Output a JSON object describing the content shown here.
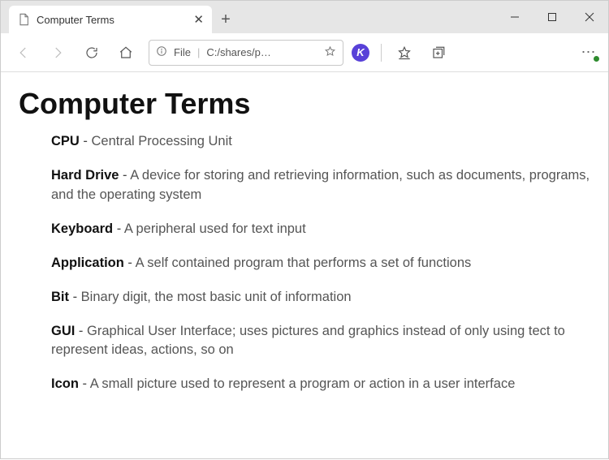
{
  "tab": {
    "title": "Computer Terms"
  },
  "address": {
    "scheme": "File",
    "path": "C:/shares/p…"
  },
  "page": {
    "heading": "Computer Terms",
    "terms": [
      {
        "term": "CPU",
        "def": "Central Processing Unit"
      },
      {
        "term": "Hard Drive",
        "def": "A device for storing and retrieving information, such as documents, programs, and the operating system"
      },
      {
        "term": "Keyboard",
        "def": "A peripheral used for text input"
      },
      {
        "term": "Application",
        "def": "A self contained program that performs a set of functions"
      },
      {
        "term": "Bit",
        "def": "Binary digit, the most basic unit of information"
      },
      {
        "term": "GUI",
        "def": "Graphical User Interface; uses pictures and graphics instead of only using tect to represent ideas, actions, so on"
      },
      {
        "term": "Icon",
        "def": "A small picture used to represent a program or action in a user interface"
      }
    ]
  }
}
